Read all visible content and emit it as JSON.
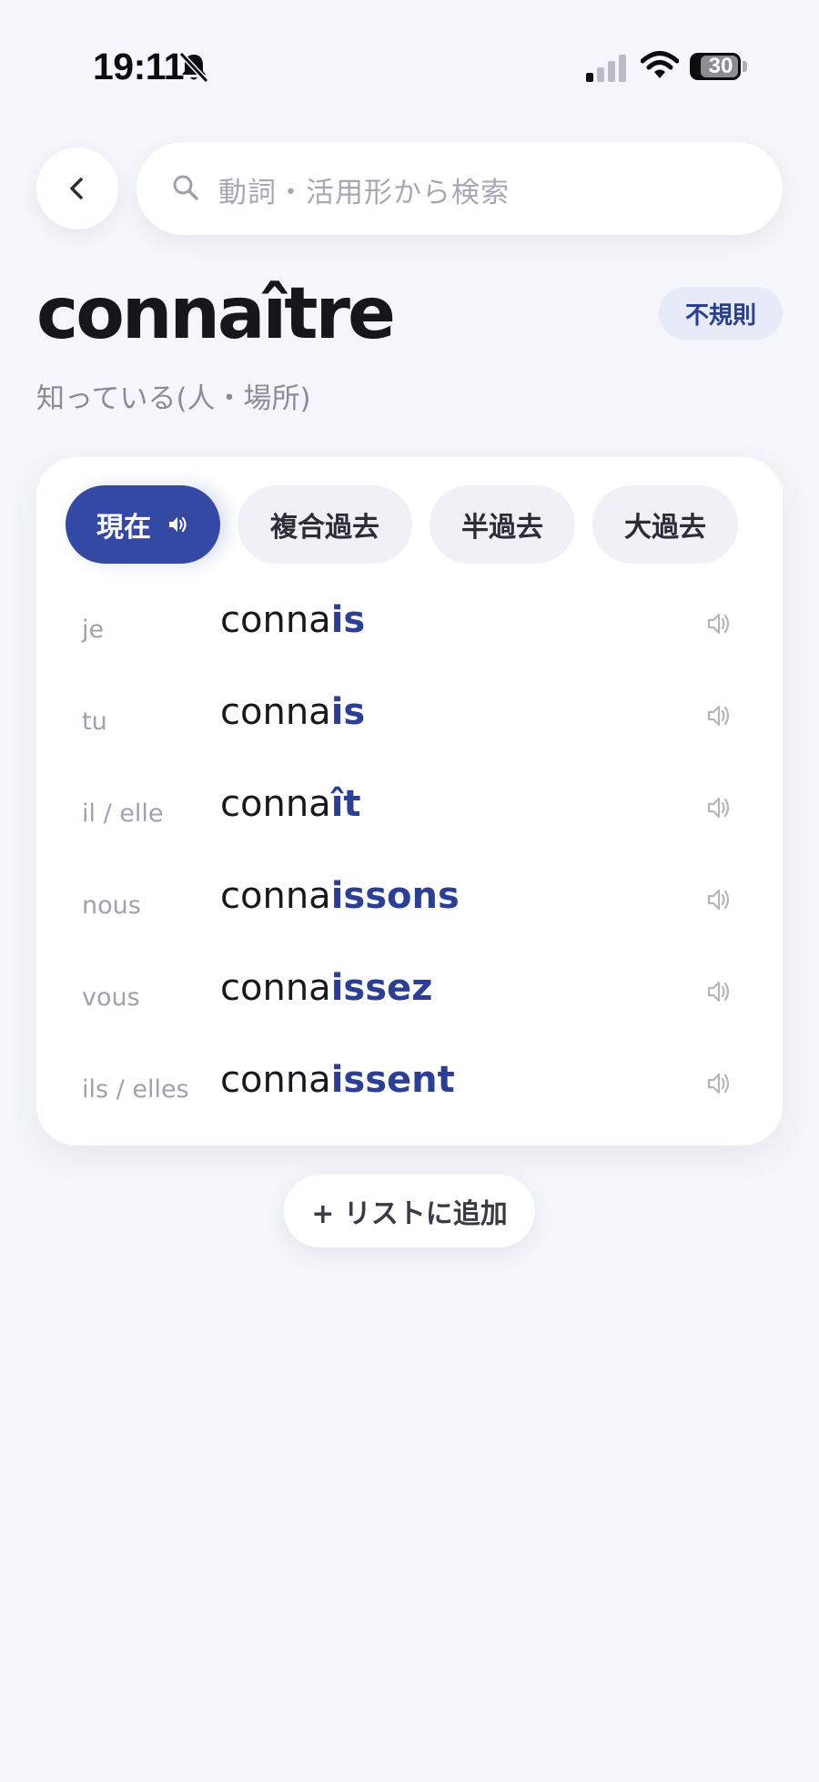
{
  "status_bar": {
    "time": "19:11",
    "battery": "30"
  },
  "search": {
    "placeholder": "動詞・活用形から検索"
  },
  "verb": {
    "infinitive": "connaître",
    "meaning": "知っている(人・場所)",
    "badge": "不規則"
  },
  "tabs": [
    {
      "label": "現在",
      "active": true
    },
    {
      "label": "複合過去",
      "active": false
    },
    {
      "label": "半過去",
      "active": false
    },
    {
      "label": "大過去",
      "active": false
    }
  ],
  "conjugations": [
    {
      "pronoun": "je",
      "stem": "conna",
      "ending": "is"
    },
    {
      "pronoun": "tu",
      "stem": "conna",
      "ending": "is"
    },
    {
      "pronoun": "il / elle",
      "stem": "conna",
      "ending": "ît"
    },
    {
      "pronoun": "nous",
      "stem": "conna",
      "ending": "issons"
    },
    {
      "pronoun": "vous",
      "stem": "conna",
      "ending": "issez"
    },
    {
      "pronoun": "ils / elles",
      "stem": "conna",
      "ending": "issent"
    }
  ],
  "actions": {
    "add_to_list": "+ リストに追加"
  },
  "colors": {
    "accent": "#3349a4",
    "ending": "#2c3f96",
    "background": "#f4f6fb"
  },
  "icons": [
    "bell-slash-icon",
    "cellular-signal-icon",
    "wifi-icon",
    "battery-icon",
    "chevron-left-icon",
    "search-icon",
    "speaker-icon"
  ]
}
